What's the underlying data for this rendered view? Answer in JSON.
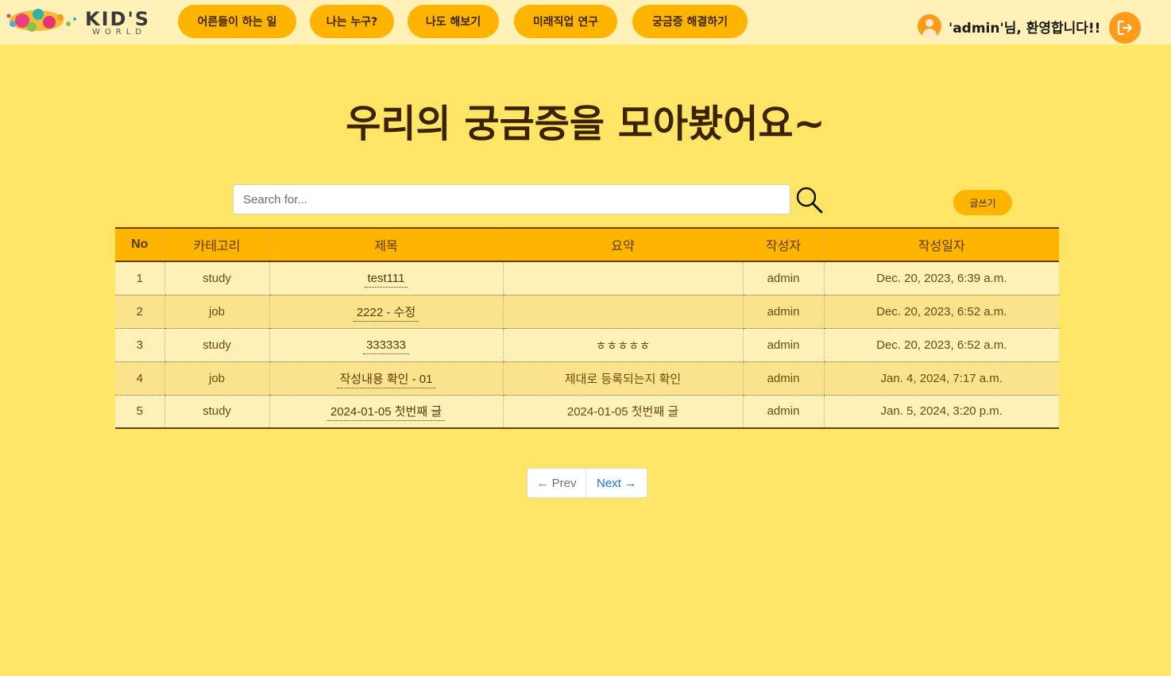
{
  "header": {
    "logo": {
      "word": "KID'S",
      "sub": "WORLD"
    },
    "nav": [
      {
        "label": "어른들이 하는 일"
      },
      {
        "label": "나는 누구?"
      },
      {
        "label": "나도 해보기"
      },
      {
        "label": "미래직업 연구"
      },
      {
        "label": "궁금증 해결하기"
      }
    ],
    "welcome": "'admin'님, 환영합니다!!"
  },
  "page": {
    "title": "우리의 궁금증을 모아봤어요~"
  },
  "search": {
    "placeholder": "Search for...",
    "write_label": "글쓰기"
  },
  "table": {
    "headers": [
      "No",
      "카테고리",
      "제목",
      "요약",
      "작성자",
      "작성일자"
    ],
    "rows": [
      {
        "no": "1",
        "category": "study",
        "title": "test111",
        "summary": "",
        "author": "admin",
        "date": "Dec. 20, 2023, 6:39 a.m."
      },
      {
        "no": "2",
        "category": "job",
        "title": "2222 - 수정",
        "summary": "",
        "author": "admin",
        "date": "Dec. 20, 2023, 6:52 a.m."
      },
      {
        "no": "3",
        "category": "study",
        "title": "333333",
        "summary": "ㅎㅎㅎㅎㅎ",
        "author": "admin",
        "date": "Dec. 20, 2023, 6:52 a.m."
      },
      {
        "no": "4",
        "category": "job",
        "title": "작성내용 확인 - 01",
        "summary": "제대로 등록되는지 확인",
        "author": "admin",
        "date": "Jan. 4, 2024, 7:17 a.m."
      },
      {
        "no": "5",
        "category": "study",
        "title": "2024-01-05 첫번째 글",
        "summary": "2024-01-05 첫번째 글",
        "author": "admin",
        "date": "Jan. 5, 2024, 3:20 p.m."
      }
    ]
  },
  "pagination": {
    "prev": "← Prev",
    "next": "Next →"
  },
  "colors": {
    "background": "#FFE566",
    "header_bg": "#FFF1B8",
    "accent": "#FFB400",
    "logout": "#FF9A1A"
  }
}
